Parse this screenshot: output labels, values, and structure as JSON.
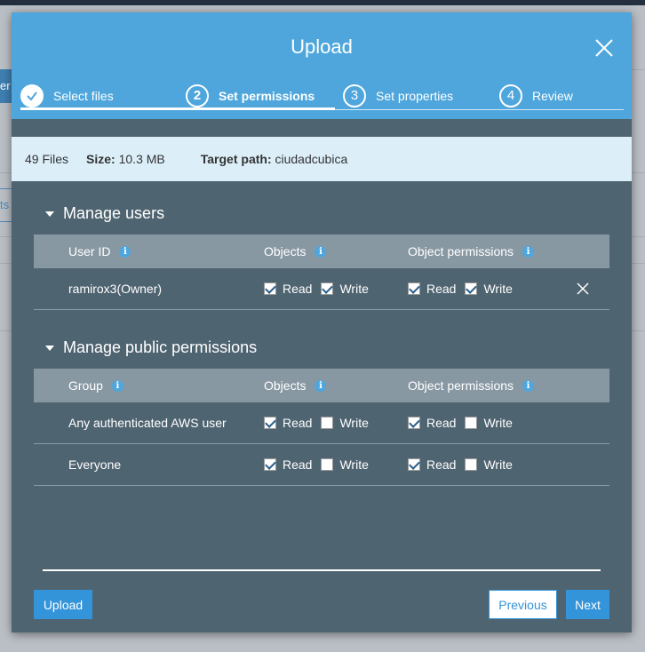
{
  "background": {
    "tab_fragment": "er",
    "link_fragment": "ts"
  },
  "modal": {
    "title": "Upload",
    "steps": [
      {
        "number": "✓",
        "label": "Select files"
      },
      {
        "number": "2",
        "label": "Set permissions"
      },
      {
        "number": "3",
        "label": "Set properties"
      },
      {
        "number": "4",
        "label": "Review"
      }
    ],
    "summary": {
      "files": "49 Files",
      "size_label": "Size:",
      "size_value": "10.3 MB",
      "path_label": "Target path:",
      "path_value": "ciudadcubica"
    }
  },
  "manage_users": {
    "title": "Manage users",
    "columns": {
      "user_id": "User ID",
      "objects": "Objects",
      "object_permissions": "Object permissions"
    },
    "rows": [
      {
        "name": "ramirox3(Owner)",
        "objects_read": true,
        "objects_write": true,
        "perm_read": true,
        "perm_write": true
      }
    ]
  },
  "public_permissions": {
    "title": "Manage public permissions",
    "columns": {
      "group": "Group",
      "objects": "Objects",
      "object_permissions": "Object permissions"
    },
    "rows": [
      {
        "name": "Any authenticated AWS user",
        "objects_read": true,
        "objects_write": false,
        "perm_read": true,
        "perm_write": false
      },
      {
        "name": "Everyone",
        "objects_read": true,
        "objects_write": false,
        "perm_read": true,
        "perm_write": false
      }
    ]
  },
  "labels": {
    "read": "Read",
    "write": "Write",
    "info": "i"
  },
  "buttons": {
    "upload": "Upload",
    "previous": "Previous",
    "next": "Next"
  },
  "colors": {
    "header": "#4ea6dc",
    "body": "#4f6471",
    "summary": "#dceff9",
    "primary": "#3394d9"
  }
}
